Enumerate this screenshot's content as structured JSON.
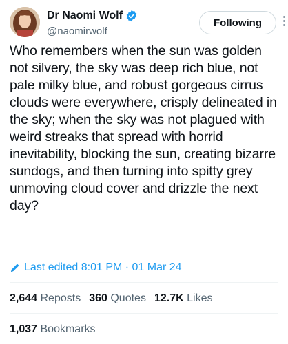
{
  "author": {
    "display_name": "Dr Naomi Wolf",
    "handle": "@naomirwolf",
    "verified": true
  },
  "follow_button": {
    "label": "Following"
  },
  "tweet": {
    "text": "Who remembers when the sun was golden not silvery, the sky was deep rich blue, not pale milky blue, and robust gorgeous cirrus clouds were everywhere, crisply delineated in the sky; when the sky was not plagued with weird streaks that spread with horrid inevitability, blocking the sun, creating bizarre sundogs, and then turning into spitty grey unmoving cloud cover and drizzle the next day?",
    "edited_label": "Last edited 8:01 PM · 01 Mar 24"
  },
  "stats": {
    "reposts_count": "2,644",
    "reposts_label": "Reposts",
    "quotes_count": "360",
    "quotes_label": "Quotes",
    "likes_count": "12.7K",
    "likes_label": "Likes",
    "bookmarks_count": "1,037",
    "bookmarks_label": "Bookmarks"
  },
  "colors": {
    "accent_blue": "#1d9bf0",
    "text_primary": "#0f1419",
    "text_secondary": "#536471"
  }
}
